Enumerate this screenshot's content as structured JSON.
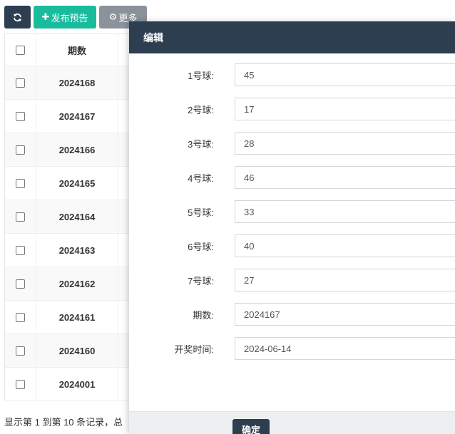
{
  "toolbar": {
    "refresh_icon": "refresh-icon",
    "publish_label": "发布预告",
    "publish_icon": "plus-icon",
    "more_label": "更多",
    "more_icon": "gear-icon"
  },
  "table": {
    "header_period": "期数",
    "rows": [
      "2024168",
      "2024167",
      "2024166",
      "2024165",
      "2024164",
      "2024163",
      "2024162",
      "2024161",
      "2024160",
      "2024001"
    ]
  },
  "footer": {
    "summary": "显示第 1 到第 10 条记录，总"
  },
  "modal": {
    "title": "编辑",
    "fields": [
      {
        "label": "1号球:",
        "value": "45"
      },
      {
        "label": "2号球:",
        "value": "17"
      },
      {
        "label": "3号球:",
        "value": "28"
      },
      {
        "label": "4号球:",
        "value": "46"
      },
      {
        "label": "5号球:",
        "value": "33"
      },
      {
        "label": "6号球:",
        "value": "40"
      },
      {
        "label": "7号球:",
        "value": "27"
      },
      {
        "label": "期数:",
        "value": "2024167"
      },
      {
        "label": "开奖时间:",
        "value": "2024-06-14"
      }
    ],
    "confirm_label": "确定"
  },
  "colors": {
    "primary": "#2c3e50",
    "success": "#18bc9c",
    "gray": "#8b929c"
  }
}
